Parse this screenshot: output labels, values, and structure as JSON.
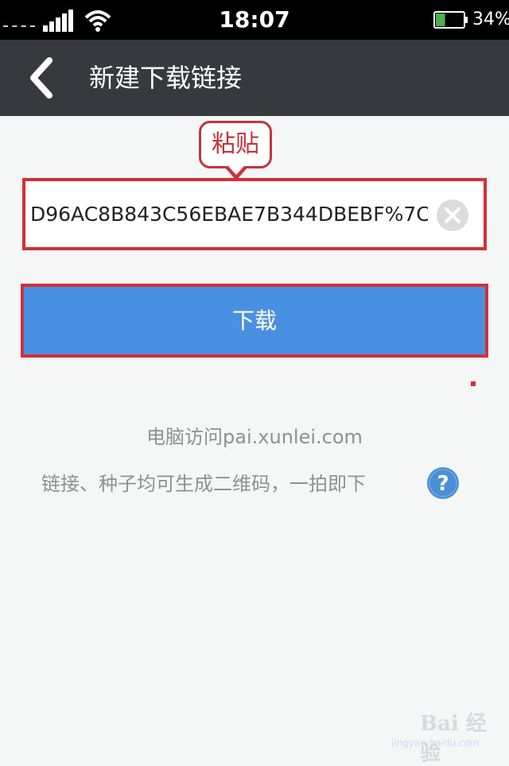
{
  "status_bar": {
    "time": "18:07",
    "battery_percent": "34%",
    "battery_level": 0.34,
    "icons": [
      "signal-icon",
      "wifi-icon",
      "battery-icon"
    ]
  },
  "app_bar": {
    "back_icon": "chevron-left-icon",
    "title": "新建下载链接"
  },
  "callout": {
    "label": "粘贴"
  },
  "url_field": {
    "value": "D96AC8B843C56EBAE7B344DBEBF%7C",
    "clear_icon": "clear-circle-icon"
  },
  "download_button": {
    "label": "下载"
  },
  "info": {
    "visit_text": "电脑访问pai.xunlei.com",
    "qr_text": "链接、种子均可生成二维码，一拍即下",
    "help_icon": "question-circle-icon"
  },
  "watermark": {
    "brand": "Bai 经验",
    "sub": "jingyan.baidu.com"
  },
  "colors": {
    "app_bar_bg": "#363a3e",
    "button_blue": "#4a90e2",
    "highlight_red": "#d32f38",
    "help_blue": "#4a8fd6"
  }
}
